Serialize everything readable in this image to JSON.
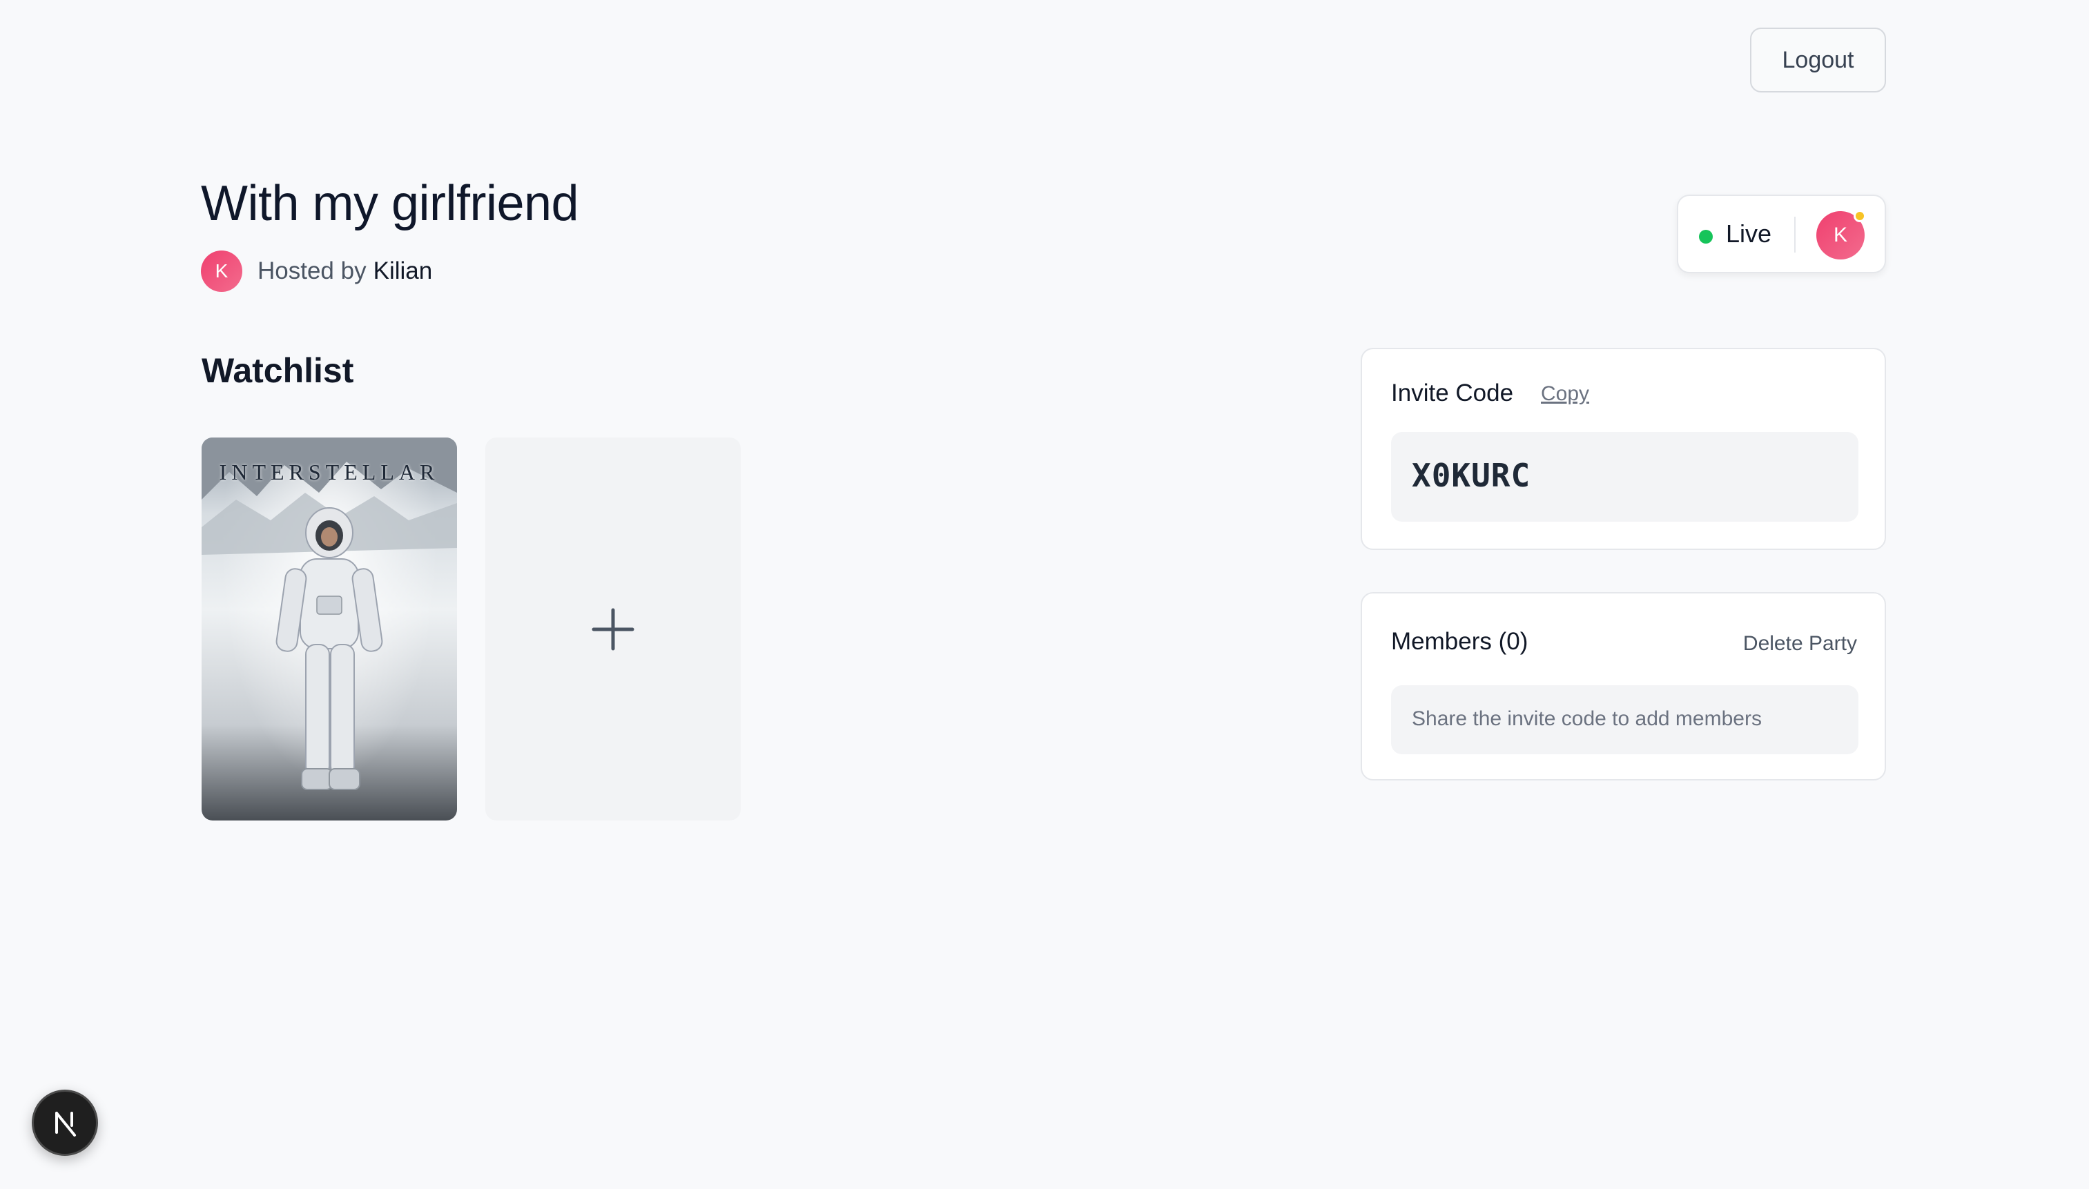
{
  "header": {
    "logout_label": "Logout"
  },
  "party": {
    "title": "With my girlfriend",
    "hosted_by_label": "Hosted by",
    "host_name": "Kilian",
    "host_initial": "K"
  },
  "status": {
    "live_label": "Live",
    "live_color": "#16c45a",
    "viewer_initial": "K",
    "presence_color": "#f7c325"
  },
  "watchlist": {
    "title": "Watchlist",
    "items": [
      {
        "poster_title": "INTERSTELLAR"
      }
    ],
    "add_icon": "plus-icon"
  },
  "invite": {
    "label": "Invite Code",
    "copy_label": "Copy",
    "code": "X0KURC"
  },
  "members": {
    "label": "Members (0)",
    "delete_label": "Delete Party",
    "empty_text": "Share the invite code to add members"
  },
  "dev_badge": {
    "letter": "N"
  },
  "colors": {
    "avatar_gradient_start": "#f0406f",
    "avatar_gradient_end": "#f26b8d",
    "background": "#f8f9fb"
  }
}
